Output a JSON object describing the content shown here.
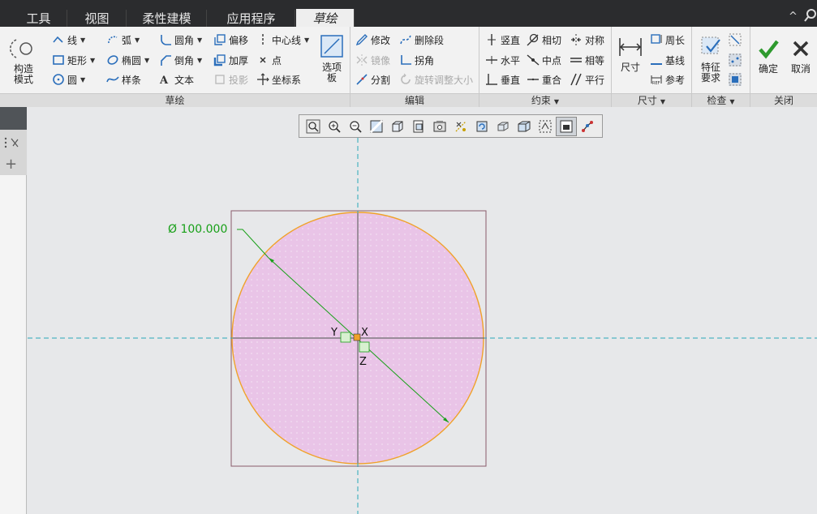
{
  "tabs": [
    {
      "label": "工具",
      "active": false
    },
    {
      "label": "视图",
      "active": false
    },
    {
      "label": "柔性建模",
      "active": false
    },
    {
      "label": "应用程序",
      "active": false
    },
    {
      "label": "草绘",
      "active": true
    }
  ],
  "ribbon": {
    "sketch_group": {
      "label": "草绘",
      "construction_mode": "构造\n模式",
      "line": "线",
      "arc": "弧",
      "fillet": "圆角",
      "offset": "偏移",
      "centerline": "中心线",
      "rectangle": "矩形",
      "ellipse": "椭圆",
      "chamfer": "倒角",
      "thicken": "加厚",
      "point": "点",
      "circle": "圆",
      "spline": "样条",
      "text": "文本",
      "project": "投影",
      "coordinate_system": "坐标系",
      "palette": "选项\n板"
    },
    "edit_group": {
      "label": "编辑",
      "modify": "修改",
      "delete_segment": "删除段",
      "mirror": "镜像",
      "corner": "拐角",
      "divide": "分割",
      "rotate_resize": "旋转调整大小"
    },
    "constraint_group": {
      "label": "约束",
      "vertical": "竖直",
      "tangent": "相切",
      "symmetric": "对称",
      "horizontal": "水平",
      "midpoint": "中点",
      "equal": "相等",
      "perpendicular": "垂直",
      "coincident": "重合",
      "parallel": "平行"
    },
    "dimension_group": {
      "label": "尺寸",
      "dimension": "尺寸",
      "perimeter": "周长",
      "baseline": "基线",
      "reference": "参考"
    },
    "inspect_group": {
      "label": "检查",
      "feature_requirements": "特征\n要求"
    },
    "close_group": {
      "label": "关闭",
      "ok": "确定",
      "cancel": "取消"
    }
  },
  "canvas": {
    "diameter_label": "Ø 100.000",
    "axis_x": "X",
    "axis_y": "Y",
    "axis_z": "Z"
  },
  "colors": {
    "accent_green": "#18a018",
    "fill": "#e9c4e7",
    "circle_edge": "#f0a22a",
    "centerline": "#2aa8b8",
    "ok_green": "#2e9a2e"
  }
}
